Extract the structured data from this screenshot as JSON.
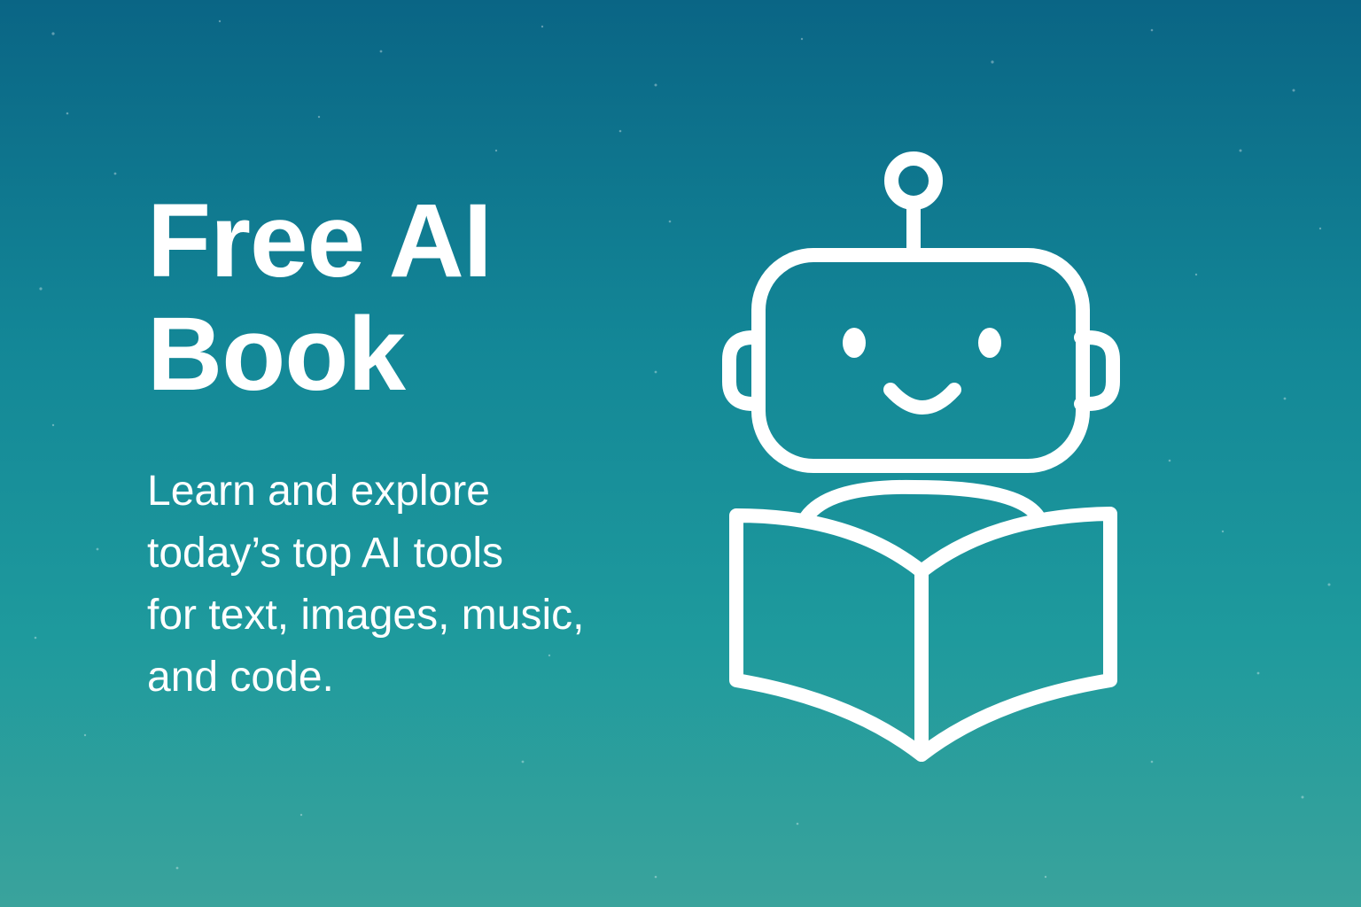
{
  "hero": {
    "title_line1": "Free AI",
    "title_line2": "Book",
    "subtitle_lines": [
      "Learn and explore",
      "today’s top AI tools",
      "for text, images, music,",
      "and code."
    ]
  },
  "illustration": {
    "icon": "robot-reading-book-icon",
    "stroke_color": "#ffffff"
  },
  "colors": {
    "background_top": "#0a6585",
    "background_bottom": "#3aa39c",
    "text": "#ffffff"
  }
}
